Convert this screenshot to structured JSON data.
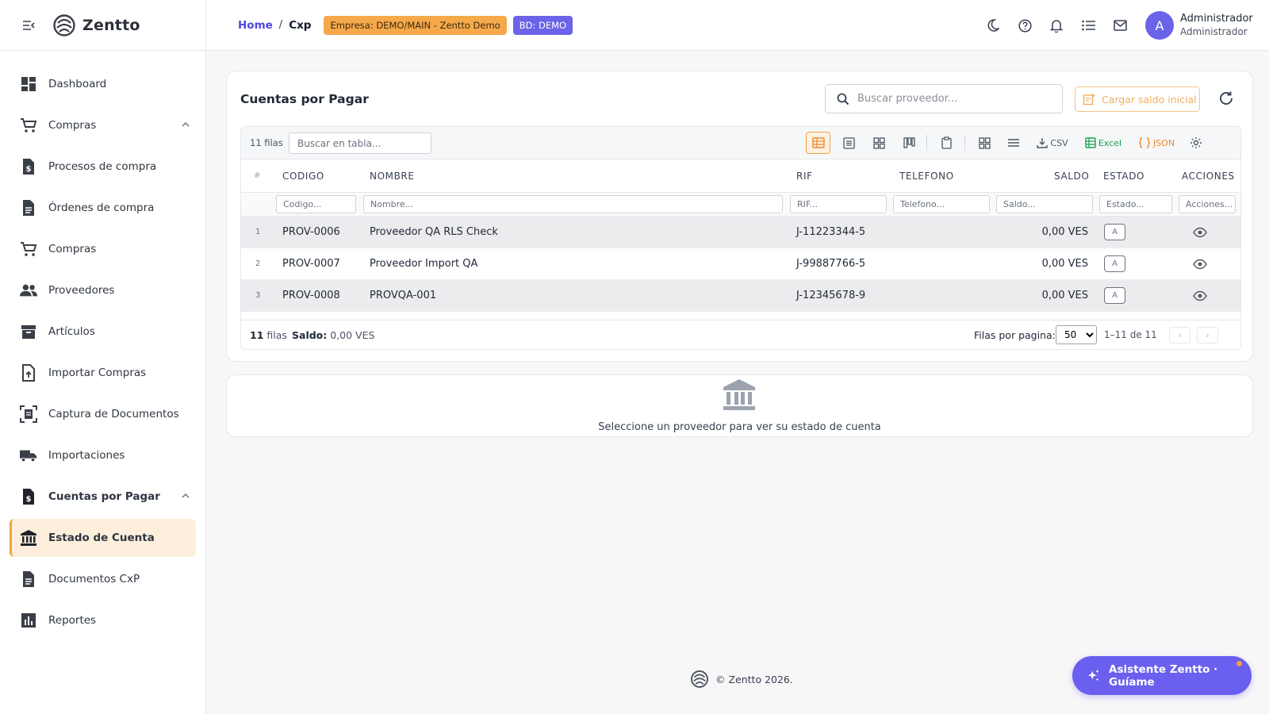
{
  "brand": {
    "name": "Zentto"
  },
  "sidebar": {
    "items": [
      {
        "label": "Dashboard"
      },
      {
        "label": "Compras"
      },
      {
        "label": "Procesos de compra"
      },
      {
        "label": "Órdenes de compra"
      },
      {
        "label": "Compras"
      },
      {
        "label": "Proveedores"
      },
      {
        "label": "Artículos"
      },
      {
        "label": "Importar Compras"
      },
      {
        "label": "Captura de Documentos"
      },
      {
        "label": "Importaciones"
      },
      {
        "label": "Cuentas por Pagar"
      },
      {
        "label": "Estado de Cuenta"
      },
      {
        "label": "Documentos CxP"
      },
      {
        "label": "Reportes"
      }
    ]
  },
  "topbar": {
    "home": "Home",
    "sep": "/",
    "current": "Cxp",
    "empresa_badge": "Empresa: DEMO/MAIN - Zentto Demo",
    "bd_badge": "BD: DEMO",
    "user_initial": "A",
    "user_name": "Administrador",
    "user_role": "Administrador"
  },
  "card": {
    "title": "Cuentas por Pagar",
    "search_placeholder": "Buscar proveedor...",
    "cargar_label": "Cargar saldo inicial"
  },
  "grid": {
    "rows_count": "11 filas",
    "table_search_placeholder": "Buscar en tabla...",
    "csv_label": "CSV",
    "excel_label": "Excel",
    "json_label": "JSON",
    "headers": {
      "idx": "#",
      "codigo": "CODIGO",
      "nombre": "NOMBRE",
      "rif": "RIF",
      "telefono": "TELEFONO",
      "saldo": "SALDO",
      "estado": "ESTADO",
      "acciones": "ACCIONES"
    },
    "filters": {
      "codigo": "Codigo...",
      "nombre": "Nombre...",
      "rif": "RIF...",
      "telefono": "Telefono...",
      "saldo": "Saldo...",
      "estado": "Estado...",
      "acciones": "Acciones..."
    },
    "rows": [
      {
        "idx": "1",
        "codigo": "PROV-0006",
        "nombre": "Proveedor QA RLS Check",
        "rif": "J-11223344-5",
        "telefono": "",
        "saldo": "0,00 VES",
        "estado": "A"
      },
      {
        "idx": "2",
        "codigo": "PROV-0007",
        "nombre": "Proveedor Import QA",
        "rif": "J-99887766-5",
        "telefono": "",
        "saldo": "0,00 VES",
        "estado": "A"
      },
      {
        "idx": "3",
        "codigo": "PROV-0008",
        "nombre": "PROVQA-001",
        "rif": "J-12345678-9",
        "telefono": "",
        "saldo": "0,00 VES",
        "estado": "A"
      }
    ],
    "footer": {
      "count_num": "11",
      "count_word": "filas",
      "saldo_label": "Saldo:",
      "saldo_value": "0,00 VES",
      "per_page_label": "Filas por pagina:",
      "per_page_value": "50",
      "range": "1–11 de 11",
      "prev": "‹",
      "next": "›"
    }
  },
  "empty": {
    "text": "Seleccione un proveedor para ver su estado de cuenta"
  },
  "footer": {
    "text": "© Zentto 2026."
  },
  "assistant": {
    "label": "Asistente Zentto · Guíame"
  },
  "colors": {
    "accent": "#6b63e8",
    "warning": "#f6a94a",
    "active_bg": "#fdefdc"
  }
}
